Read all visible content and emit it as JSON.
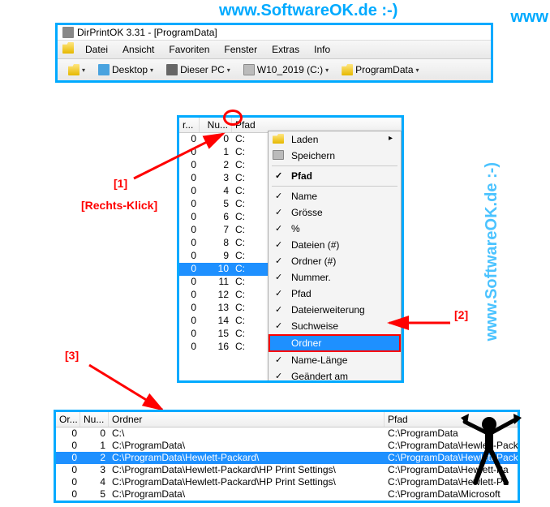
{
  "watermark_text": "www.SoftwareOK.de :-)",
  "watermark_partial": "www",
  "window": {
    "title": "DirPrintOK 3.31 - [ProgramData]",
    "menu": [
      "Datei",
      "Ansicht",
      "Favoriten",
      "Fenster",
      "Extras",
      "Info"
    ],
    "toolbar": {
      "desktop": "Desktop",
      "pc": "Dieser PC",
      "drive": "W10_2019 (C:)",
      "folder": "ProgramData"
    }
  },
  "mid": {
    "head_r": "r...",
    "head_nu": "Nu...",
    "head_pf": "Pfad",
    "rows": [
      {
        "r": "0",
        "n": "0",
        "p": "C:"
      },
      {
        "r": "0",
        "n": "1",
        "p": "C:"
      },
      {
        "r": "0",
        "n": "2",
        "p": "C:"
      },
      {
        "r": "0",
        "n": "3",
        "p": "C:"
      },
      {
        "r": "0",
        "n": "4",
        "p": "C:"
      },
      {
        "r": "0",
        "n": "5",
        "p": "C:"
      },
      {
        "r": "0",
        "n": "6",
        "p": "C:"
      },
      {
        "r": "0",
        "n": "7",
        "p": "C:"
      },
      {
        "r": "0",
        "n": "8",
        "p": "C:"
      },
      {
        "r": "0",
        "n": "9",
        "p": "C:"
      },
      {
        "r": "0",
        "n": "10",
        "p": "C:"
      },
      {
        "r": "0",
        "n": "11",
        "p": "C:"
      },
      {
        "r": "0",
        "n": "12",
        "p": "C:"
      },
      {
        "r": "0",
        "n": "13",
        "p": "C:"
      },
      {
        "r": "0",
        "n": "14",
        "p": "C:"
      },
      {
        "r": "0",
        "n": "15",
        "p": "C:"
      },
      {
        "r": "0",
        "n": "16",
        "p": "C:"
      }
    ],
    "selected_index": 10
  },
  "ctx": {
    "laden": "Laden",
    "speichern": "Speichern",
    "pfad_bold": "Pfad",
    "items_checked": [
      "Name",
      "Grösse",
      "%",
      "Dateien (#)",
      "Ordner (#)",
      "Nummer.",
      "Pfad",
      "Dateierweiterung",
      "Suchweise"
    ],
    "ordner": "Ordner",
    "name_laenge": "Name-Länge",
    "geaendert": "Geändert am"
  },
  "anno": {
    "one": "[1]",
    "two": "[2]",
    "three": "[3]",
    "rclick": "[Rechts-Klick]"
  },
  "bottom": {
    "head_or": "Or...",
    "head_nu": "Nu...",
    "head_ordner": "Ordner",
    "head_pfad": "Pfad",
    "rows": [
      {
        "o": "0",
        "n": "0",
        "ord": "C:\\",
        "pf": "C:\\ProgramData"
      },
      {
        "o": "0",
        "n": "1",
        "ord": "C:\\ProgramData\\",
        "pf": "C:\\ProgramData\\Hewlett-Pack"
      },
      {
        "o": "0",
        "n": "2",
        "ord": "C:\\ProgramData\\Hewlett-Packard\\",
        "pf": "C:\\ProgramData\\Hewlett-Pack"
      },
      {
        "o": "0",
        "n": "3",
        "ord": "C:\\ProgramData\\Hewlett-Packard\\HP Print Settings\\",
        "pf": "C:\\ProgramData\\Hewlett-Pa"
      },
      {
        "o": "0",
        "n": "4",
        "ord": "C:\\ProgramData\\Hewlett-Packard\\HP Print Settings\\",
        "pf": "C:\\ProgramData\\Hewlett-Pa"
      },
      {
        "o": "0",
        "n": "5",
        "ord": "C:\\ProgramData\\",
        "pf": "C:\\ProgramData\\Microsoft"
      }
    ],
    "selected_index": 2
  }
}
